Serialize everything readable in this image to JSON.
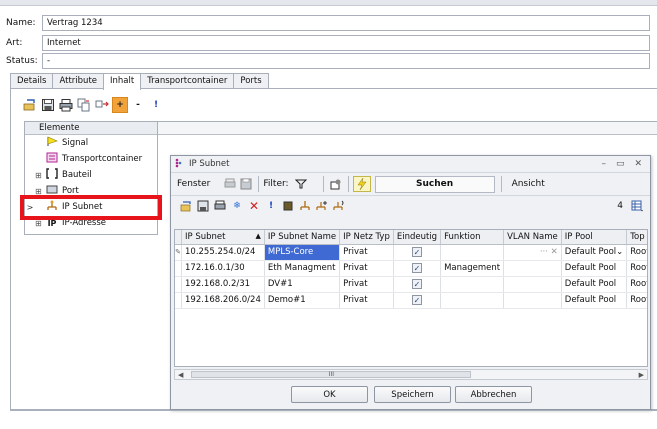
{
  "form": {
    "name_label": "Name:",
    "name_value": "Vertrag 1234",
    "art_label": "Art:",
    "art_value": "Internet",
    "status_label": "Status:",
    "status_value": "-"
  },
  "tabs": [
    {
      "label": "Details"
    },
    {
      "label": "Attribute"
    },
    {
      "label": "Inhalt"
    },
    {
      "label": "Transportcontainer"
    },
    {
      "label": "Ports"
    }
  ],
  "main_toolbar": {
    "add_symbol": "+",
    "remove_symbol": "-",
    "alert_symbol": "!"
  },
  "tree": {
    "header": "Elemente",
    "items": [
      {
        "label": "Signal"
      },
      {
        "label": "Transportcontainer"
      },
      {
        "label": "Bauteil"
      },
      {
        "label": "Port"
      },
      {
        "label": "IP Subnet"
      },
      {
        "label": "IP-Adresse"
      }
    ]
  },
  "dialog": {
    "title": "IP Subnet",
    "toolbar": {
      "fenster": "Fenster",
      "filter": "Filter:",
      "suchen": "Suchen",
      "ansicht": "Ansicht"
    },
    "count": "4",
    "columns": [
      "IP Subnet",
      "IP Subnet Name",
      "IP Netz Typ",
      "Eindeutig",
      "Funktion",
      "VLAN Name",
      "IP Pool",
      "Top Sub"
    ],
    "rows": [
      {
        "subnet": "10.255.254.0/24",
        "name": "MPLS-Core",
        "typ": "Privat",
        "eindeutig": true,
        "funktion": "",
        "vlan": "",
        "pool": "Default Pool",
        "top": "Root"
      },
      {
        "subnet": "172.16.0.1/30",
        "name": "Eth Managment",
        "typ": "Privat",
        "eindeutig": true,
        "funktion": "Management",
        "vlan": "",
        "pool": "Default Pool",
        "top": "Root"
      },
      {
        "subnet": "192.168.0.2/31",
        "name": "DV#1",
        "typ": "Privat",
        "eindeutig": true,
        "funktion": "",
        "vlan": "",
        "pool": "Default Pool",
        "top": "Root"
      },
      {
        "subnet": "192.168.206.0/24",
        "name": "Demo#1",
        "typ": "Privat",
        "eindeutig": true,
        "funktion": "",
        "vlan": "",
        "pool": "Default Pool",
        "top": "Root"
      }
    ],
    "scroll_grip": "III",
    "buttons": {
      "ok": "OK",
      "save": "Speichern",
      "cancel": "Abbrechen"
    }
  },
  "colors": {
    "highlight": "#e8141c",
    "selection": "#3f6ad4",
    "toolbar_orange": "#f2a23a"
  }
}
